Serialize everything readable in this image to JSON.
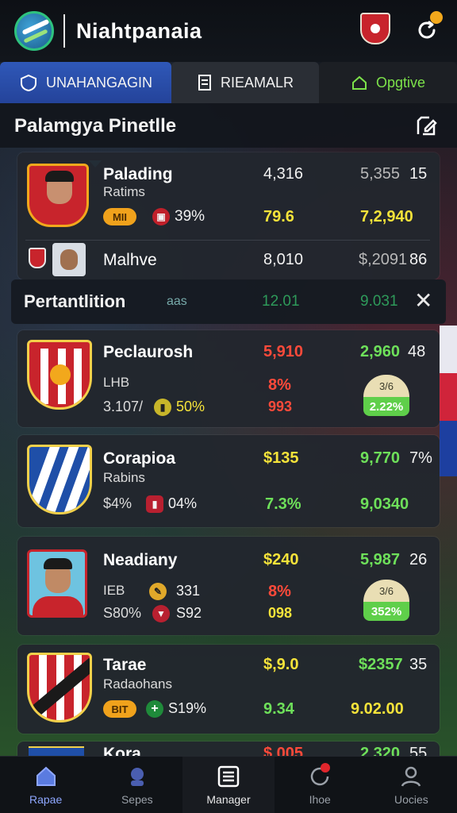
{
  "header": {
    "title": "Niahtpanaia"
  },
  "tabs": [
    {
      "label": "UNAHANGAGIN"
    },
    {
      "label": "RIEAMALR"
    },
    {
      "label": "Opgtive"
    }
  ],
  "section": {
    "title": "Palamgya Pinetlle"
  },
  "rows": [
    {
      "name": "Palading",
      "sub": "Ratims",
      "pill": "MII",
      "pct": "39%",
      "v1": "4,316",
      "v2": "5,355",
      "v3": "15",
      "v4": "79.6",
      "v5": "7,2,940"
    },
    {
      "name": "Malhve",
      "v1": "8,010",
      "v2": "$,2091",
      "v3": "86"
    }
  ],
  "subsection": {
    "title": "Pertantlition",
    "tag": "aas",
    "v1": "12.01",
    "v2": "9.031"
  },
  "cards": [
    {
      "name": "Peclaurosh",
      "sub": "LHB",
      "stat1": "3.107/",
      "pct": "50%",
      "v1": "5,910",
      "v2": "2,960",
      "v3": "48",
      "v4": "8%",
      "v5": "993",
      "mini_top": "3/6",
      "mini_bot": "2.22%"
    },
    {
      "name": "Corapioa",
      "sub": "Rabins",
      "stat1": "$4%",
      "pct": "04%",
      "v1": "$135",
      "v2": "9,770",
      "v3": "7%",
      "v4": "7.3%",
      "v5": "9,0340"
    },
    {
      "name": "Neadiany",
      "sub": "IEB",
      "stat1": "S80%",
      "pct": "331",
      "pct2": "S92",
      "v1": "$240",
      "v2": "5,987",
      "v3": "26",
      "v4": "8%",
      "v5": "098",
      "mini_top": "3/6",
      "mini_bot": "352%"
    },
    {
      "name": "Tarae",
      "sub": "Radaohans",
      "pill": "BIT",
      "pct": "S19%",
      "v1": "$,9.0",
      "v2": "$2357",
      "v3": "35",
      "v4": "9.34",
      "v5": "9.02.00"
    },
    {
      "name": "Kora",
      "v1": "$,005",
      "v2": "2,320",
      "v3": "55"
    }
  ],
  "nav": [
    {
      "label": "Rapae"
    },
    {
      "label": "Sepes"
    },
    {
      "label": "Manager"
    },
    {
      "label": "Ihoe"
    },
    {
      "label": "Uocies"
    }
  ],
  "colors": {
    "accent": "#2f58b8",
    "positive": "#6ee05a",
    "negative": "#ff4a3a",
    "highlight": "#f5e33a"
  }
}
